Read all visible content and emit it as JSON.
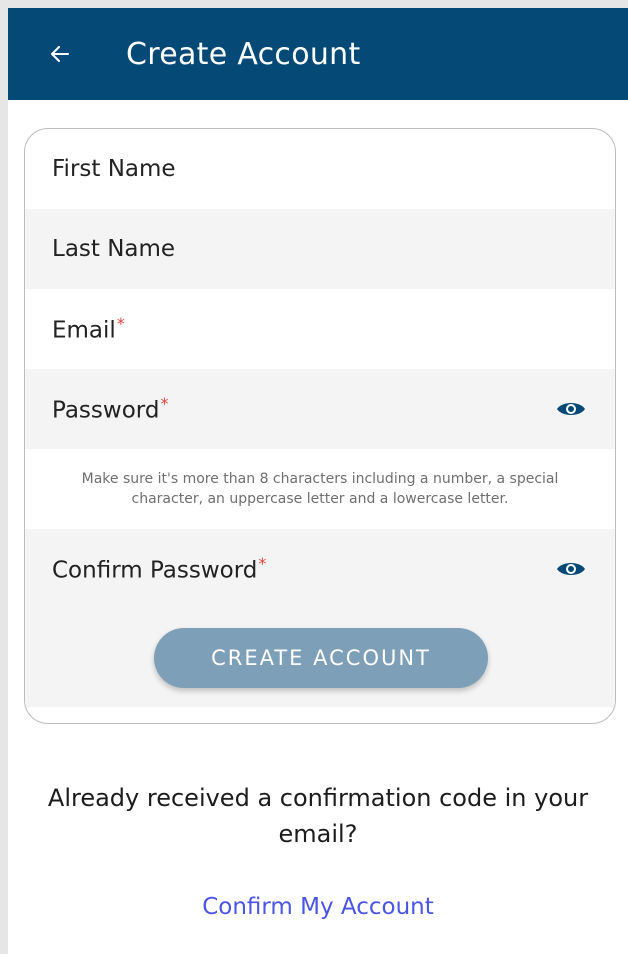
{
  "header": {
    "title": "Create Account",
    "back_icon": "arrow-left-icon",
    "background": "#054a77"
  },
  "form": {
    "first_name_label": "First Name",
    "last_name_label": "Last Name",
    "email_label": "Email",
    "password_label": "Password",
    "password_hint": "Make sure it's more than 8 characters including a number, a special character, an uppercase letter and a lowercase letter.",
    "confirm_password_label": "Confirm Password",
    "required_marker": "*",
    "visibility_icon": "eye-icon",
    "submit_label": "CREATE ACCOUNT"
  },
  "footer": {
    "prompt": "Already received a confirmation code in your email?",
    "confirm_link": "Confirm My Account"
  },
  "colors": {
    "accent": "#054a77",
    "button": "#7d9fb8",
    "link": "#4a56e2",
    "required": "#e0453d"
  }
}
